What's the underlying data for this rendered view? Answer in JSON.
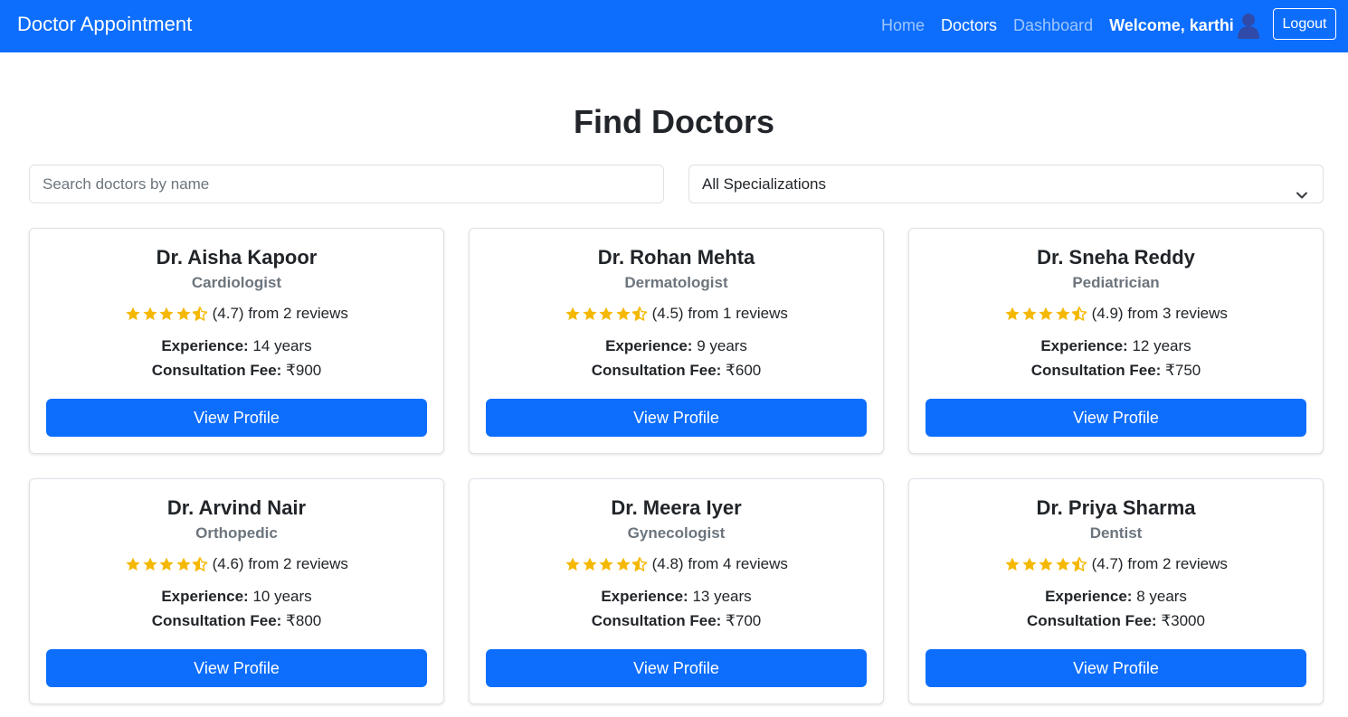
{
  "navbar": {
    "brand": "Doctor Appointment",
    "links": [
      {
        "label": "Home",
        "active": false
      },
      {
        "label": "Doctors",
        "active": true
      },
      {
        "label": "Dashboard",
        "active": false
      }
    ],
    "welcome": "Welcome, karthi",
    "logout_label": "Logout",
    "avatar_icon": "user-avatar-icon"
  },
  "page": {
    "title": "Find Doctors"
  },
  "filters": {
    "search_placeholder": "Search doctors by name",
    "search_value": "",
    "specialization_selected": "All Specializations"
  },
  "doctor_labels": {
    "experience_label": "Experience:",
    "fee_label": "Consultation Fee:",
    "view_profile_label": "View Profile"
  },
  "doctors": [
    {
      "name": "Dr. Aisha Kapoor",
      "specialization": "Cardiologist",
      "rating_text": "(4.7) from 2 reviews",
      "rating": 4.7,
      "experience": "14 years",
      "fee": "₹900"
    },
    {
      "name": "Dr. Rohan Mehta",
      "specialization": "Dermatologist",
      "rating_text": "(4.5) from 1 reviews",
      "rating": 4.5,
      "experience": "9 years",
      "fee": "₹600"
    },
    {
      "name": "Dr. Sneha Reddy",
      "specialization": "Pediatrician",
      "rating_text": "(4.9) from 3 reviews",
      "rating": 4.9,
      "experience": "12 years",
      "fee": "₹750"
    },
    {
      "name": "Dr. Arvind Nair",
      "specialization": "Orthopedic",
      "rating_text": "(4.6) from 2 reviews",
      "rating": 4.6,
      "experience": "10 years",
      "fee": "₹800"
    },
    {
      "name": "Dr. Meera Iyer",
      "specialization": "Gynecologist",
      "rating_text": "(4.8) from 4 reviews",
      "rating": 4.8,
      "experience": "13 years",
      "fee": "₹700"
    },
    {
      "name": "Dr. Priya Sharma",
      "specialization": "Dentist",
      "rating_text": "(4.7) from 2 reviews",
      "rating": 4.7,
      "experience": "8 years",
      "fee": "₹3000"
    }
  ],
  "colors": {
    "primary": "#0d6efd",
    "star": "#f5b800",
    "muted": "#6c757d"
  }
}
